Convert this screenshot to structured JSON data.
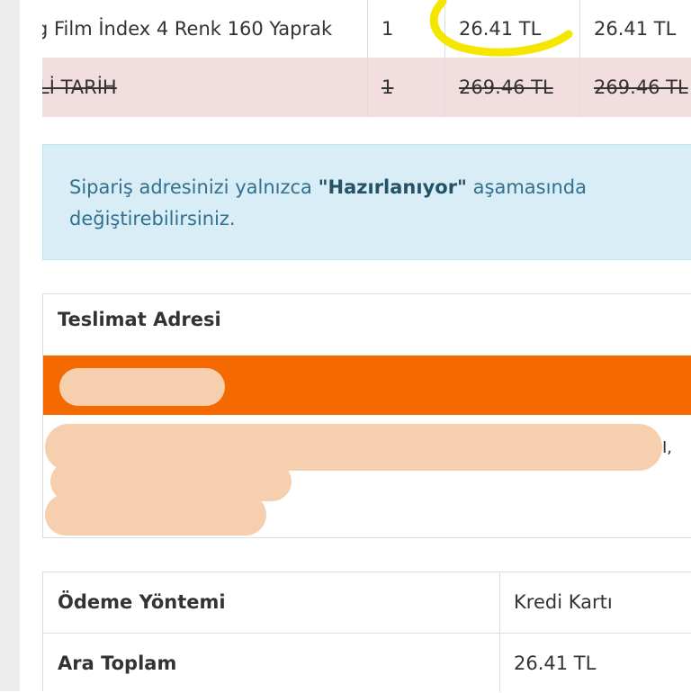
{
  "items": [
    {
      "name": "g Film İndex 4 Renk 160 Yaprak",
      "quantity": "1",
      "unit_price": "26.41 TL",
      "total": "26.41 TL",
      "cancelled": false
    },
    {
      "name": "Lİ TARİH",
      "quantity": "1",
      "unit_price": "269.46 TL",
      "total": "269.46 TL",
      "cancelled": true
    }
  ],
  "notice": {
    "prefix": "Sipariş adresinizi yalnızca ",
    "status": "\"Hazırlanıyor\"",
    "suffix": " aşamasında değiştirebilirsiniz."
  },
  "delivery_address": {
    "heading": "Teslimat Adresi",
    "visible_tail": "I,"
  },
  "summary": {
    "payment_method_label": "Ödeme Yöntemi",
    "payment_method_value": "Kredi Kartı",
    "subtotal_label": "Ara Toplam",
    "subtotal_value": "26.41 TL"
  },
  "colors": {
    "alert_background": "#d9edf7",
    "alert_text": "#31708f",
    "cancelled_row": "#f2dede",
    "address_bar": "#f56a00",
    "highlighter": "#f5e600",
    "redaction": "#f5cfae"
  }
}
